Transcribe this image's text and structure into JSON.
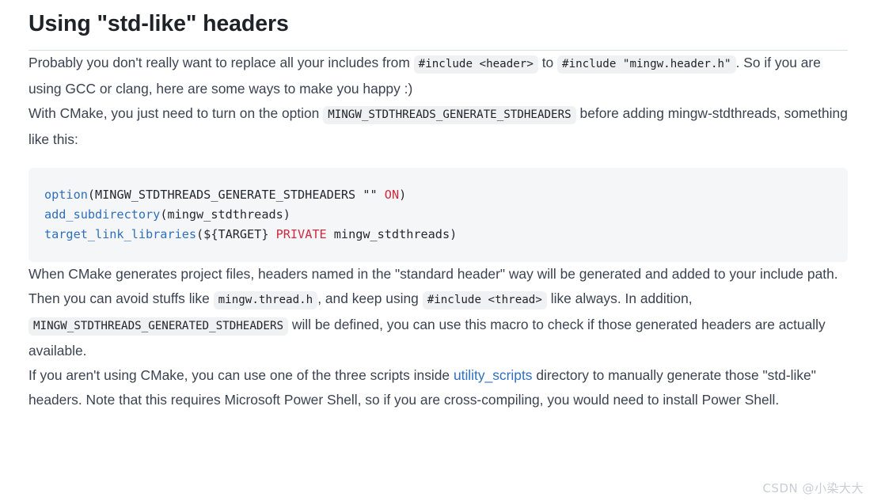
{
  "document": {
    "title": "Using \"std-like\" headers",
    "paragraphs": [
      {
        "id": "p1",
        "segments": [
          {
            "type": "text",
            "value": "Probably you don't really want to replace all your includes from "
          },
          {
            "type": "code",
            "value": "#include <header>"
          },
          {
            "type": "text",
            "value": " to "
          },
          {
            "type": "code",
            "value": "#include \"mingw.header.h\""
          },
          {
            "type": "text",
            "value": ". So if you are using GCC or clang, here are some ways to make you happy :)"
          }
        ]
      },
      {
        "id": "p2",
        "segments": [
          {
            "type": "text",
            "value": "With CMake, you just need to turn on the option "
          },
          {
            "type": "code",
            "value": "MINGW_STDTHREADS_GENERATE_STDHEADERS"
          },
          {
            "type": "text",
            "value": " before adding mingw-stdthreads, something like this:"
          }
        ]
      },
      {
        "id": "p3",
        "segments": [
          {
            "type": "text",
            "value": "When CMake generates project files, headers named in the \"standard header\" way will be generated and added to your include path. Then you can avoid stuffs like "
          },
          {
            "type": "code",
            "value": "mingw.thread.h"
          },
          {
            "type": "text",
            "value": ", and keep using "
          },
          {
            "type": "code",
            "value": "#include <thread>"
          },
          {
            "type": "text",
            "value": " like always. In addition, "
          },
          {
            "type": "code",
            "value": "MINGW_STDTHREADS_GENERATED_STDHEADERS"
          },
          {
            "type": "text",
            "value": " will be defined, you can use this macro to check if those generated headers are actually available."
          }
        ]
      },
      {
        "id": "p4",
        "segments": [
          {
            "type": "text",
            "value": "If you aren't using CMake, you can use one of the three scripts inside "
          },
          {
            "type": "link",
            "value": "utility_scripts"
          },
          {
            "type": "text",
            "value": " directory to manually generate those \"std-like\" headers. Note that this requires Microsoft Power Shell, so if you are cross-compiling, you would need to install Power Shell."
          }
        ]
      }
    ],
    "code_block": {
      "language": "cmake",
      "lines": [
        [
          {
            "cls": "tok-fn",
            "t": "option"
          },
          {
            "cls": "tok-plain",
            "t": "(MINGW_STDTHREADS_GENERATE_STDHEADERS "
          },
          {
            "cls": "tok-str",
            "t": "\"\""
          },
          {
            "cls": "tok-plain",
            "t": " "
          },
          {
            "cls": "tok-kw",
            "t": "ON"
          },
          {
            "cls": "tok-plain",
            "t": ")"
          }
        ],
        [
          {
            "cls": "tok-fn",
            "t": "add_subdirectory"
          },
          {
            "cls": "tok-plain",
            "t": "(mingw_stdthreads)"
          }
        ],
        [
          {
            "cls": "tok-fn",
            "t": "target_link_libraries"
          },
          {
            "cls": "tok-plain",
            "t": "(${TARGET} "
          },
          {
            "cls": "tok-kw",
            "t": "PRIVATE"
          },
          {
            "cls": "tok-plain",
            "t": " mingw_stdthreads)"
          }
        ]
      ]
    },
    "watermark": "CSDN @小染大大",
    "colors": {
      "text": "#3b4351",
      "heading": "#1f2328",
      "link": "#2f6fbb",
      "code_fn": "#2f6fbb",
      "code_kw": "#cf2a3f",
      "code_bg": "#f5f6f8",
      "inline_code_bg": "#f0f1f3",
      "rule": "#d8dee4",
      "watermark": "#c9cdd4"
    }
  }
}
